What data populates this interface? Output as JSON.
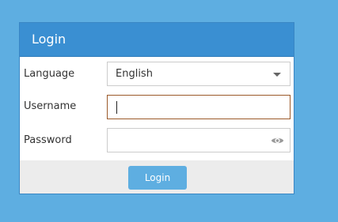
{
  "panel": {
    "title": "Login"
  },
  "form": {
    "language_label": "Language",
    "language_value": "English",
    "username_label": "Username",
    "username_value": "",
    "password_label": "Password",
    "password_value": "",
    "submit_label": "Login"
  },
  "icons": {
    "language_dropdown": "chevron-down-icon",
    "password_visibility": "eye-icon"
  },
  "colors": {
    "background": "#5eaee1",
    "header": "#3a8fd2",
    "footer": "#ececec",
    "button": "#5eaee1",
    "focused_border": "#9b5a2a"
  }
}
